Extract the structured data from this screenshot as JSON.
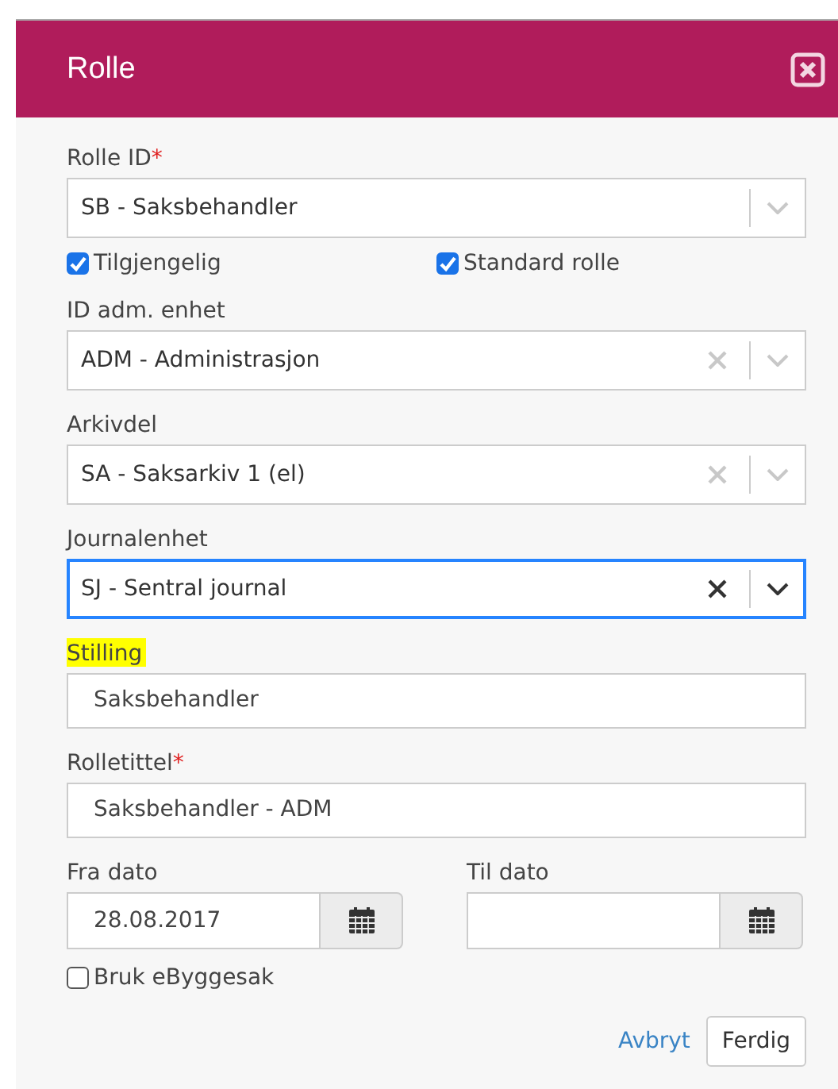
{
  "dialog": {
    "title": "Rolle"
  },
  "rows": [
    {
      "kind": "select",
      "label": "Rolle ID",
      "required_mark": "*",
      "value": "SB - Saksbehandler",
      "clearable": false,
      "focused": false
    },
    {
      "kind": "checks",
      "items": [
        {
          "label": "Tilgjengelig",
          "checked": true
        },
        {
          "label": "Standard rolle",
          "checked": true
        }
      ]
    },
    {
      "kind": "select",
      "label": "ID adm. enhet",
      "value": "ADM - Administrasjon",
      "clearable": true,
      "focused": false
    },
    {
      "kind": "select",
      "label": "Arkivdel",
      "value": "SA - Saksarkiv 1 (el)",
      "clearable": true,
      "focused": false
    },
    {
      "kind": "select",
      "label": "Journalenhet",
      "value": "SJ - Sentral journal",
      "clearable": true,
      "focused": true
    },
    {
      "kind": "text",
      "label": "Stilling",
      "highlighted": true,
      "value": "Saksbehandler"
    },
    {
      "kind": "text",
      "label": "Rolletittel",
      "required_mark": "*",
      "value": "Saksbehandler - ADM"
    },
    {
      "kind": "dates",
      "items": [
        {
          "label": "Fra dato",
          "value": "28.08.2017"
        },
        {
          "label": "Til dato"
        }
      ]
    },
    {
      "kind": "check",
      "label": "Bruk eByggesak",
      "checked": false
    }
  ],
  "actions": {
    "cancel": "Avbryt",
    "confirm": "Ferdig"
  }
}
